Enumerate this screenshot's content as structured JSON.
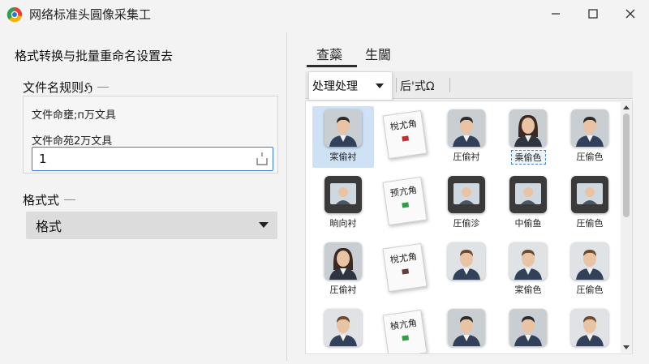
{
  "window": {
    "title": "网络标准头圓像采集工"
  },
  "left": {
    "title": "格式转换与批量重命名设置去",
    "name_rules_label": "文件名规则ℌ",
    "rule_line1": "文件命壅;п万文具",
    "rule_line2": "文件命苑2万文具",
    "number_value": "1",
    "format_label": "格式式",
    "format_value": "格式"
  },
  "tabs": [
    {
      "label": "查蘂",
      "active": true
    },
    {
      "label": "生閫",
      "active": false
    }
  ],
  "toolbar": {
    "dropdown_value": "处理处理",
    "after_label": "后'式Ω"
  },
  "gallery": {
    "items": [
      {
        "type": "photo",
        "caption": "寀偷衬",
        "variant": "man-dark"
      },
      {
        "type": "card",
        "caption": "",
        "card_text": "梲尤角",
        "mark_color": "#c03030"
      },
      {
        "type": "photo",
        "caption": "圧偷衬",
        "variant": "man-dark"
      },
      {
        "type": "photo",
        "caption": "乘偷色",
        "variant": "woman"
      },
      {
        "type": "photo",
        "caption": "圧偷色",
        "variant": "man-dark"
      },
      {
        "type": "photo",
        "caption": "晌向衬",
        "variant": "tablet"
      },
      {
        "type": "card",
        "caption": "",
        "card_text": "预亢角",
        "mark_color": "#2f9e44"
      },
      {
        "type": "photo",
        "caption": "圧偷沴",
        "variant": "tablet"
      },
      {
        "type": "photo",
        "caption": "中偷鱼",
        "variant": "tablet"
      },
      {
        "type": "photo",
        "caption": "圧偷色",
        "variant": "tablet"
      },
      {
        "type": "photo",
        "caption": "圧偷衬",
        "variant": "woman"
      },
      {
        "type": "card",
        "caption": "",
        "card_text": "梲尤角",
        "mark_color": "#6a3a3a"
      },
      {
        "type": "photo",
        "caption": "",
        "variant": "man-light"
      },
      {
        "type": "photo",
        "caption": "寀偷色",
        "variant": "man-light"
      },
      {
        "type": "photo",
        "caption": "圧偷色",
        "variant": "man-light"
      },
      {
        "type": "photo",
        "caption": "",
        "variant": "man-light"
      },
      {
        "type": "card",
        "caption": "",
        "card_text": "楨亢角",
        "mark_color": "#2f9e44"
      },
      {
        "type": "photo",
        "caption": "",
        "variant": "man-dark"
      },
      {
        "type": "photo",
        "caption": "",
        "variant": "man-dark"
      },
      {
        "type": "photo",
        "caption": "",
        "variant": "man-light"
      }
    ]
  },
  "colors": {
    "accent": "#3b7bd4",
    "selection": "#cfe1f5"
  },
  "icons": [
    "app-icon",
    "minimize-icon",
    "maximize-icon",
    "close-icon",
    "chevron-down-icon",
    "spin-icon",
    "scroll-up-icon",
    "scroll-down-icon"
  ]
}
